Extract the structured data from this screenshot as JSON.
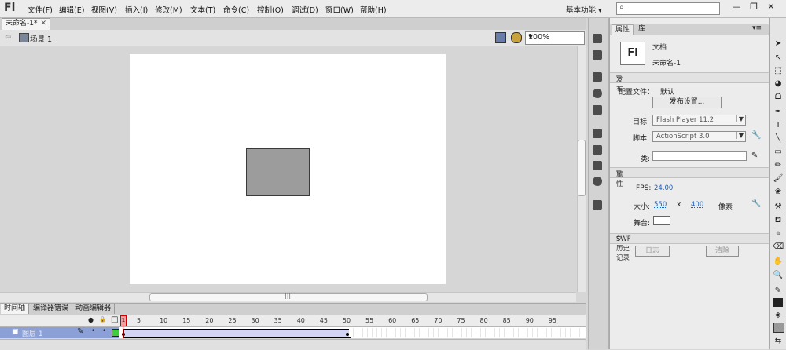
{
  "app": {
    "logo": "Fl"
  },
  "menu": {
    "items": [
      "文件(F)",
      "编辑(E)",
      "视图(V)",
      "插入(I)",
      "修改(M)",
      "文本(T)",
      "命令(C)",
      "控制(O)",
      "调试(D)",
      "窗口(W)",
      "帮助(H)"
    ],
    "workspace": "基本功能",
    "workspace_arrow": "▾",
    "search_icon": "⌕"
  },
  "window_controls": {
    "minimize": "—",
    "restore": "❐",
    "close": "✕"
  },
  "document": {
    "tab_title": "未命名-1*",
    "tab_close": "✕"
  },
  "editbar": {
    "scene": "场景 1",
    "back": "⇦",
    "zoom": "100%"
  },
  "stage": {
    "background": "#ffffff",
    "shape_fill": "#9d9c9d"
  },
  "timeline": {
    "tabs": [
      "时间轴",
      "编译器错误",
      "动画编辑器"
    ],
    "header_icons": {
      "eye": "●",
      "lock": "🔒",
      "outline": "□"
    },
    "frame_numbers": [
      "5",
      "10",
      "15",
      "20",
      "25",
      "30",
      "35",
      "40",
      "45",
      "50",
      "55",
      "60",
      "65",
      "70",
      "75",
      "80",
      "85",
      "90",
      "95"
    ],
    "current_frame": "1",
    "layer": {
      "name": "图层 1",
      "pencil": "✎",
      "dot": "•"
    }
  },
  "properties": {
    "tabs": [
      "属性",
      "库"
    ],
    "doc_icon": "Fl",
    "doc_type": "文档",
    "doc_name": "未命名-1",
    "publish_section": "发布",
    "profile_label": "配置文件：",
    "profile_value": "默认",
    "publish_settings_btn": "发布设置...",
    "target_label": "目标:",
    "target_value": "Flash Player 11.2",
    "script_label": "脚本:",
    "script_value": "ActionScript 3.0",
    "class_label": "类:",
    "class_value": "",
    "properties_section": "属性",
    "fps_label": "FPS:",
    "fps_value": "24.00",
    "size_label": "大小:",
    "width": "550",
    "x_label": "x",
    "height": "400",
    "unit": "像素",
    "stage_label": "舞台:",
    "swf_section": "SWF 历史记录",
    "log_btn": "日志",
    "clear_btn": "清除",
    "section_arrow": "▽"
  }
}
